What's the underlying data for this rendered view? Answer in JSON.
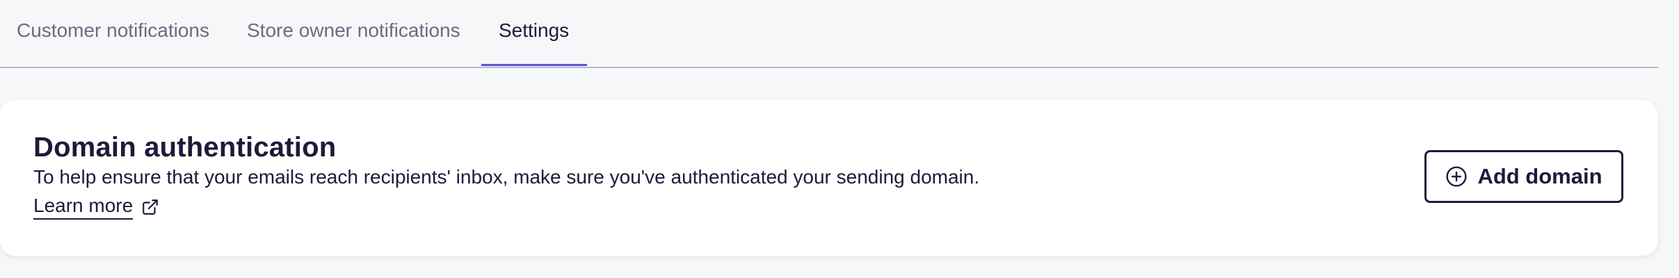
{
  "tabs": [
    {
      "label": "Customer notifications",
      "active": false
    },
    {
      "label": "Store owner notifications",
      "active": false
    },
    {
      "label": "Settings",
      "active": true
    }
  ],
  "domain_auth": {
    "title": "Domain authentication",
    "description": "To help ensure that your emails reach recipients' inbox, make sure you've authenticated your sending domain.",
    "learn_more": "Learn more",
    "learn_more_icon": "external-link-icon",
    "add_button_label": "Add domain",
    "add_button_icon": "plus-circle-icon"
  },
  "colors": {
    "accent": "#5b54d6",
    "text": "#1b1b3a",
    "muted_text": "#6b6c7e",
    "background": "#f6f7f9"
  }
}
